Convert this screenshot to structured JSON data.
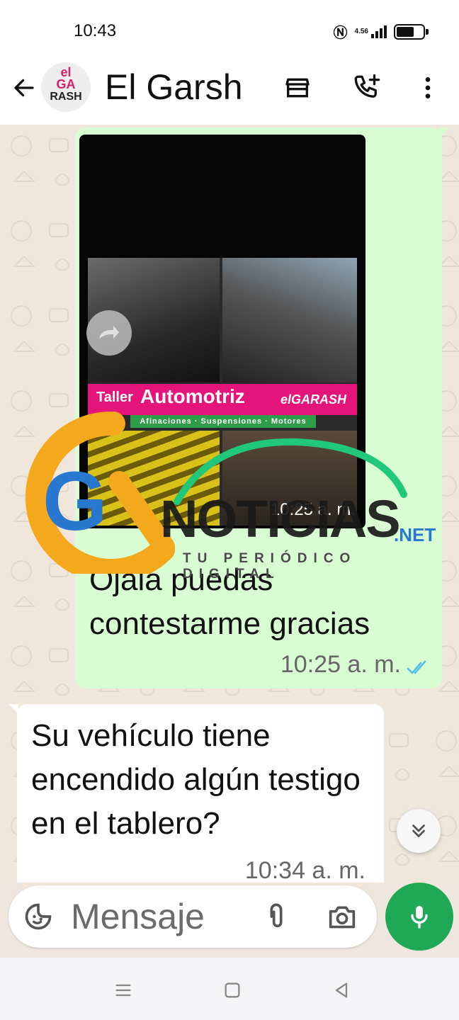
{
  "status_bar": {
    "time": "10:43",
    "network_speed": "4.56",
    "battery_percent": 70
  },
  "header": {
    "contact_name": "El Garsh",
    "avatar_text": [
      "el",
      "GA",
      "RASH"
    ]
  },
  "media": {
    "flyer_title_small": "Taller",
    "flyer_title_big": "Automotriz",
    "flyer_brand": "elGARASH",
    "flyer_subtitle": "Afinaciones · Suspensiones · Motores",
    "time": "10:25 a. m."
  },
  "messages": [
    {
      "direction": "outgoing",
      "text": "Ojalá puedas contestarme gracias",
      "time": "10:25 a. m.",
      "status": "read"
    },
    {
      "direction": "incoming",
      "text": "Su vehículo tiene encendido algún testigo en el tablero?",
      "time": "10:34 a. m."
    }
  ],
  "watermark": {
    "logo": "GN",
    "name": "NOTICIAS",
    "domain": ".NET",
    "tagline": "TU PERIÓDICO DIGITAL"
  },
  "composer": {
    "placeholder": "Mensaje"
  },
  "colors": {
    "outgoing_bubble": "#d9fdd3",
    "incoming_bubble": "#ffffff",
    "accent_green": "#1fa855",
    "read_ticks": "#53bdeb",
    "chat_background": "#efe6dc"
  }
}
